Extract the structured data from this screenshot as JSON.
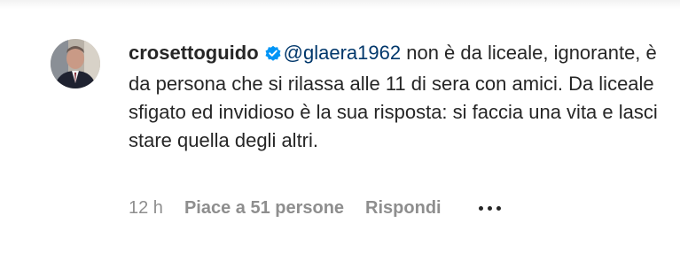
{
  "comment": {
    "username": "crosettoguido",
    "verified_icon": "verified-badge-icon",
    "mention": "@glaera1962",
    "text": " non è da liceale, ignorante, è da persona che si rilassa alle 11 di sera con amici. Da liceale sfigato ed invidioso è la sua risposta: si faccia una vita e lasci stare quella degli altri."
  },
  "meta": {
    "time": "12 h",
    "likes": "Piace a 51 persone",
    "reply": "Rispondi",
    "more_icon": "more-options-icon"
  },
  "colors": {
    "text": "#262626",
    "mention": "#00376b",
    "muted": "#8e8e8e",
    "verified": "#0095f6"
  }
}
